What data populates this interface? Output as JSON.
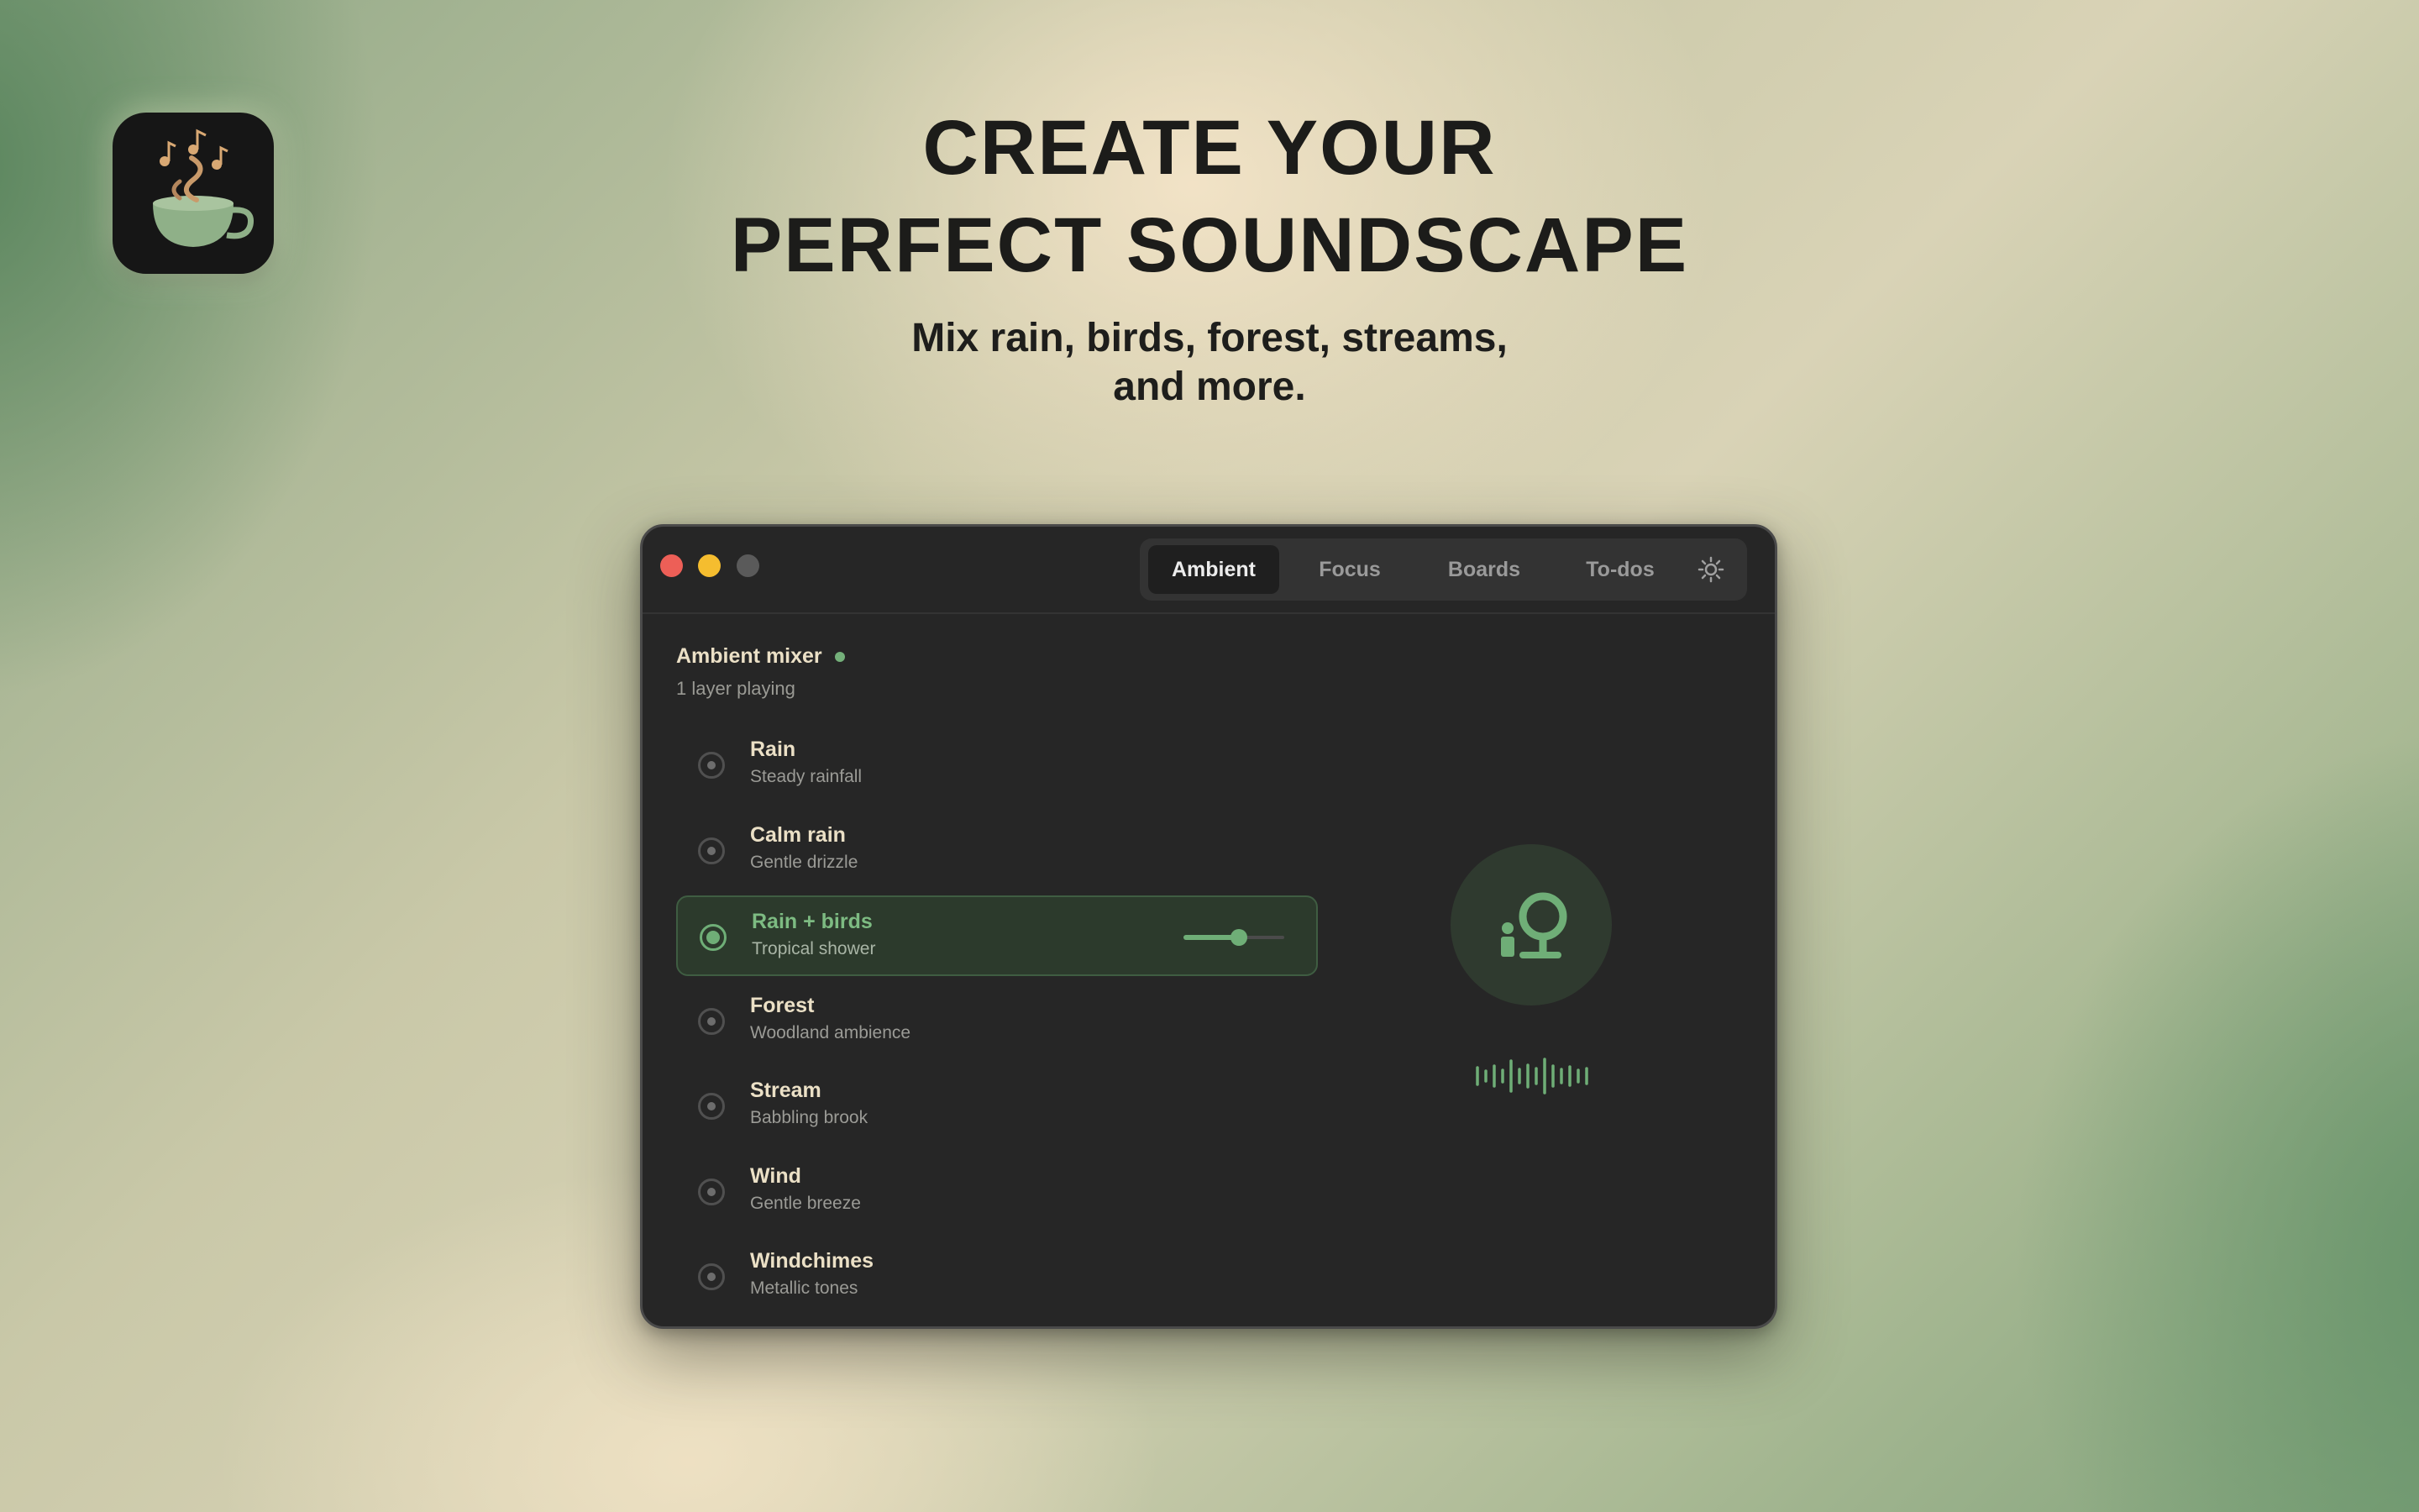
{
  "hero": {
    "title_line1": "CREATE YOUR",
    "title_line2": "PERFECT SOUNDSCAPE",
    "subtitle_line1": "Mix rain, birds, forest, streams,",
    "subtitle_line2": "and more."
  },
  "app_icon": {
    "icon": "coffee-cup-music-notes-icon"
  },
  "window": {
    "tabs": [
      {
        "label": "Ambient",
        "active": true
      },
      {
        "label": "Focus",
        "active": false
      },
      {
        "label": "Boards",
        "active": false
      },
      {
        "label": "To-dos",
        "active": false
      }
    ],
    "settings_icon": "sun-icon",
    "mixer": {
      "title": "Ambient mixer",
      "status": "1 layer playing",
      "layers": [
        {
          "name": "Rain",
          "description": "Steady rainfall",
          "active": false
        },
        {
          "name": "Calm rain",
          "description": "Gentle drizzle",
          "active": false
        },
        {
          "name": "Rain + birds",
          "description": "Tropical shower",
          "active": true,
          "volume": 0.55
        },
        {
          "name": "Forest",
          "description": "Woodland ambience",
          "active": false
        },
        {
          "name": "Stream",
          "description": "Babbling brook",
          "active": false
        },
        {
          "name": "Wind",
          "description": "Gentle breeze",
          "active": false
        },
        {
          "name": "Windchimes",
          "description": "Metallic tones",
          "active": false
        }
      ]
    },
    "visualizer": {
      "icon": "person-at-tree-icon",
      "waveform_icon": "waveform-icon"
    },
    "colors": {
      "accent": "#6fae77",
      "window_bg": "#262626",
      "text_primary": "#ebe0c6"
    }
  }
}
